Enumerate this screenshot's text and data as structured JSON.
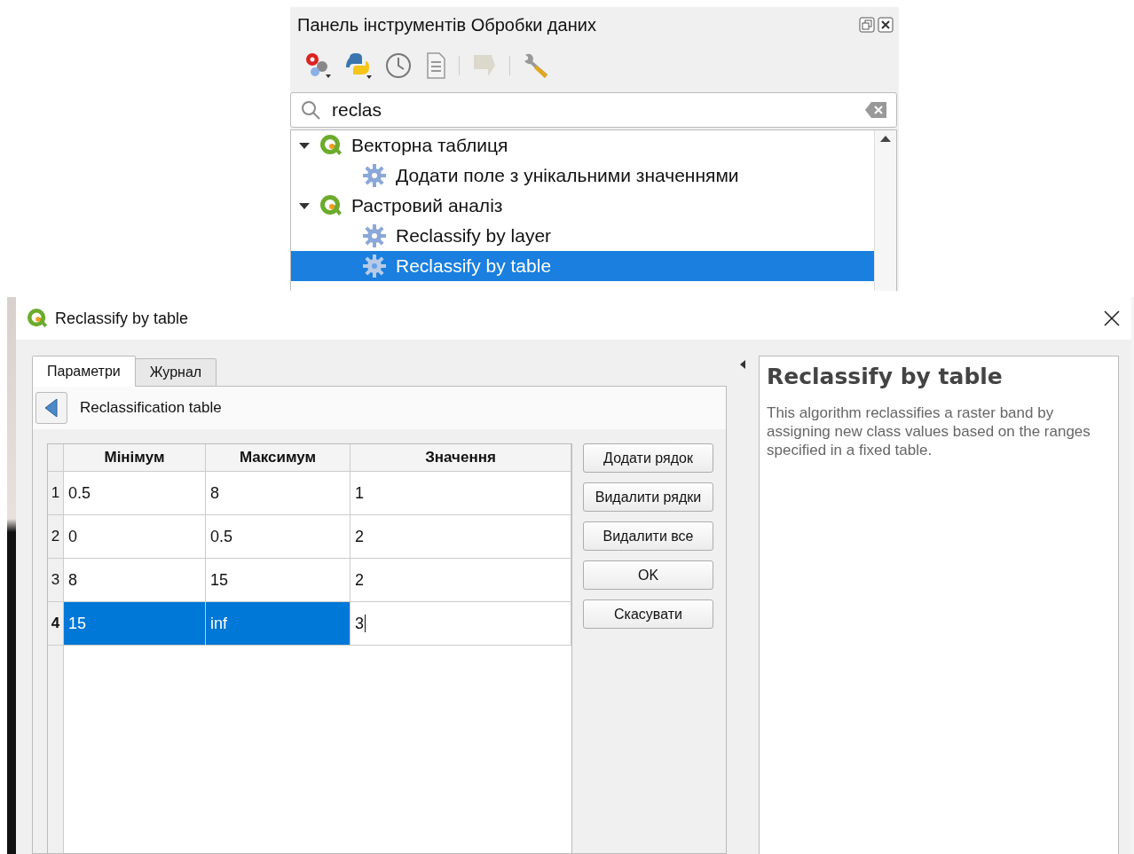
{
  "toolbox": {
    "title": "Панель інструментів Обробки даних",
    "tools": [
      {
        "kind": "models",
        "disabled": false
      },
      {
        "kind": "python",
        "disabled": false
      },
      {
        "kind": "history",
        "disabled": false
      },
      {
        "kind": "results",
        "disabled": false
      },
      {
        "kind": "edit",
        "disabled": true
      },
      {
        "kind": "options",
        "disabled": false
      }
    ],
    "search": {
      "value": "reclas"
    },
    "tree": [
      {
        "label": "Векторна таблиця",
        "kind": "provider",
        "expanded": true,
        "selected": false,
        "children": [
          {
            "label": "Додати поле з унікальними значеннями",
            "kind": "algorithm",
            "selected": false
          }
        ]
      },
      {
        "label": "Растровий аналіз",
        "kind": "provider",
        "expanded": true,
        "selected": false,
        "children": [
          {
            "label": "Reclassify by layer",
            "kind": "algorithm",
            "selected": false
          },
          {
            "label": "Reclassify by table",
            "kind": "algorithm",
            "selected": true
          }
        ]
      }
    ]
  },
  "dialog": {
    "title": "Reclassify by table",
    "tabs": [
      {
        "label": "Параметри",
        "selected": true
      },
      {
        "label": "Журнал",
        "selected": false
      }
    ],
    "panel_title": "Reclassification table",
    "table": {
      "columns": [
        "Мінімум",
        "Максимум",
        "Значення"
      ],
      "rows": [
        {
          "number": "1",
          "current": false,
          "cells": [
            {
              "text": "0.5",
              "selected": false,
              "editing": false
            },
            {
              "text": "8",
              "selected": false,
              "editing": false
            },
            {
              "text": "1",
              "selected": false,
              "editing": false
            }
          ]
        },
        {
          "number": "2",
          "current": false,
          "cells": [
            {
              "text": "0",
              "selected": false,
              "editing": false
            },
            {
              "text": "0.5",
              "selected": false,
              "editing": false
            },
            {
              "text": "2",
              "selected": false,
              "editing": false
            }
          ]
        },
        {
          "number": "3",
          "current": false,
          "cells": [
            {
              "text": "8",
              "selected": false,
              "editing": false
            },
            {
              "text": "15",
              "selected": false,
              "editing": false
            },
            {
              "text": "2",
              "selected": false,
              "editing": false
            }
          ]
        },
        {
          "number": "4",
          "current": true,
          "cells": [
            {
              "text": "15",
              "selected": true,
              "editing": false
            },
            {
              "text": "inf",
              "selected": true,
              "editing": false
            },
            {
              "text": "3",
              "selected": false,
              "editing": true
            }
          ]
        }
      ]
    },
    "buttons": [
      "Додати рядок",
      "Видалити рядки",
      "Видалити все",
      "OK",
      "Скасувати"
    ],
    "help": {
      "title": "Reclassify by table",
      "text": "This algorithm reclassifies a raster band by assigning new class values based on the ranges specified in a fixed table."
    }
  }
}
